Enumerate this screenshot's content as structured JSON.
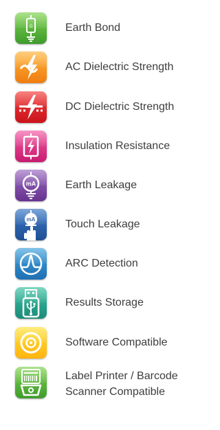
{
  "features": [
    {
      "label": "Earth Bond",
      "icon": "earth-bond-icon",
      "color": "#4caf3a"
    },
    {
      "label": "AC Dielectric Strength",
      "icon": "ac-dielectric-icon",
      "color": "#f28a1c"
    },
    {
      "label": "DC Dielectric Strength",
      "icon": "dc-dielectric-icon",
      "color": "#d61f26"
    },
    {
      "label": "Insulation Resistance",
      "icon": "insulation-resistance-icon",
      "color": "#e0338a"
    },
    {
      "label": "Earth Leakage",
      "icon": "earth-leakage-icon",
      "color": "#7b4aa5",
      "badge_text": "mA"
    },
    {
      "label": "Touch Leakage",
      "icon": "touch-leakage-icon",
      "color": "#2a5fa8",
      "badge_text": "mA"
    },
    {
      "label": "ARC Detection",
      "icon": "arc-detection-icon",
      "color": "#2d88c8"
    },
    {
      "label": "Results Storage",
      "icon": "usb-storage-icon",
      "color": "#27a58d"
    },
    {
      "label": "Software Compatible",
      "icon": "disc-icon",
      "color": "#ffc61e"
    },
    {
      "label_line1": "Label Printer / Barcode",
      "label_line2": "Scanner Compatible",
      "icon": "barcode-scanner-icon",
      "color": "#4caf3a"
    }
  ]
}
